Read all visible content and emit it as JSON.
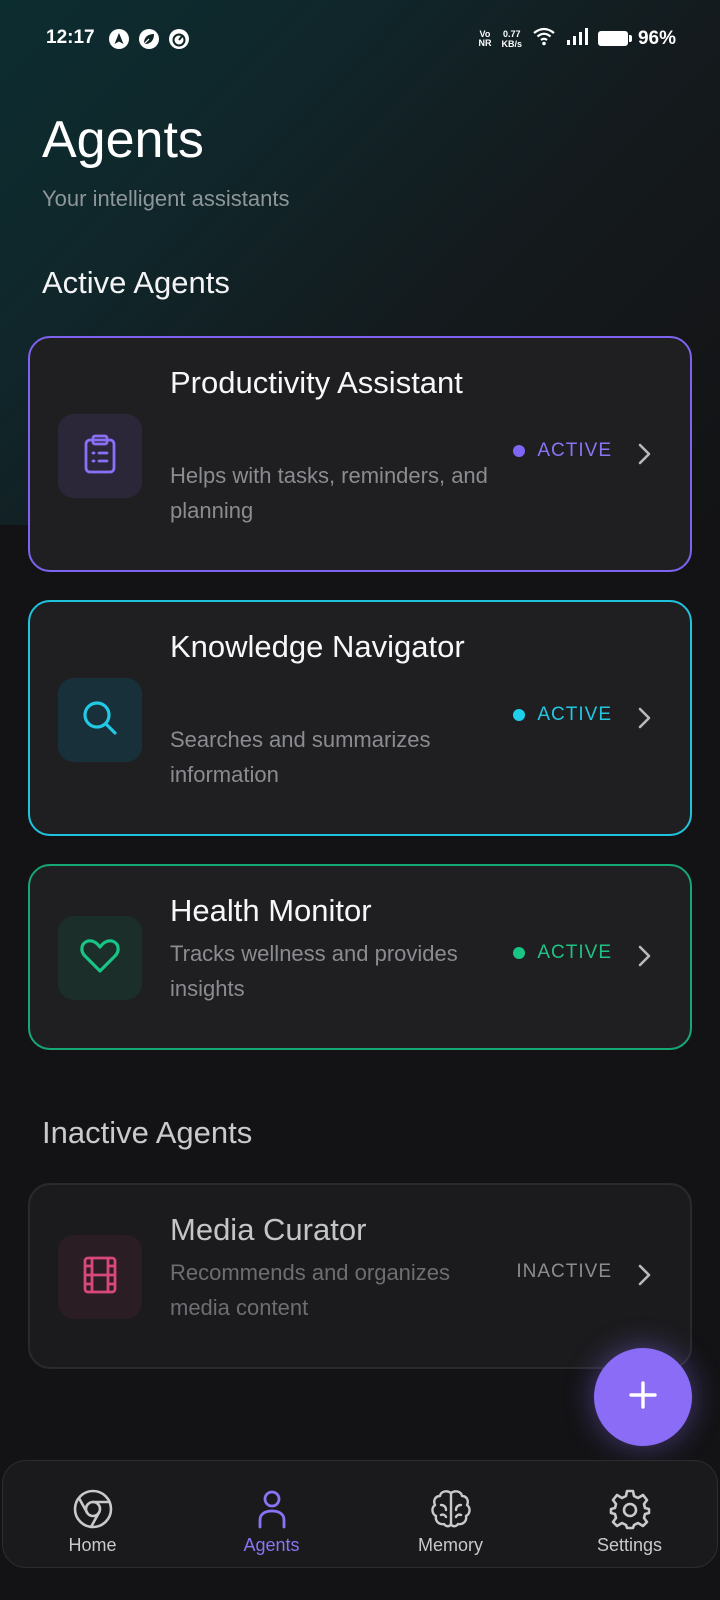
{
  "status_bar": {
    "time": "12:17",
    "network_label_top": "Vo",
    "network_label_bottom": "NR",
    "speed_value": "0.77",
    "speed_unit": "KB/s",
    "battery": "96%"
  },
  "header": {
    "title": "Agents",
    "subtitle": "Your intelligent assistants"
  },
  "sections": {
    "active_title": "Active Agents",
    "inactive_title": "Inactive Agents"
  },
  "agents": [
    {
      "title": "Productivity Assistant",
      "description": "Helps with tasks, reminders, and planning",
      "status": "ACTIVE",
      "icon": "clipboard-list-icon",
      "accent": "#7d63f0"
    },
    {
      "title": "Knowledge Navigator",
      "description": "Searches and summarizes information",
      "status": "ACTIVE",
      "icon": "search-icon",
      "accent": "#1fc3dd"
    },
    {
      "title": "Health Monitor",
      "description": "Tracks wellness and provides insights",
      "status": "ACTIVE",
      "icon": "heart-icon",
      "accent": "#16a874"
    },
    {
      "title": "Media Curator",
      "description": "Recommends and organizes media content",
      "status": "INACTIVE",
      "icon": "film-icon",
      "accent": "#d9487a"
    }
  ],
  "fab": {
    "icon": "plus-icon",
    "color": "#8a6cf6"
  },
  "bottom_nav": {
    "items": [
      {
        "label": "Home",
        "icon": "chrome-icon"
      },
      {
        "label": "Agents",
        "icon": "user-icon",
        "active": true
      },
      {
        "label": "Memory",
        "icon": "brain-icon"
      },
      {
        "label": "Settings",
        "icon": "gear-icon"
      }
    ],
    "active_color": "#8b73f5"
  }
}
